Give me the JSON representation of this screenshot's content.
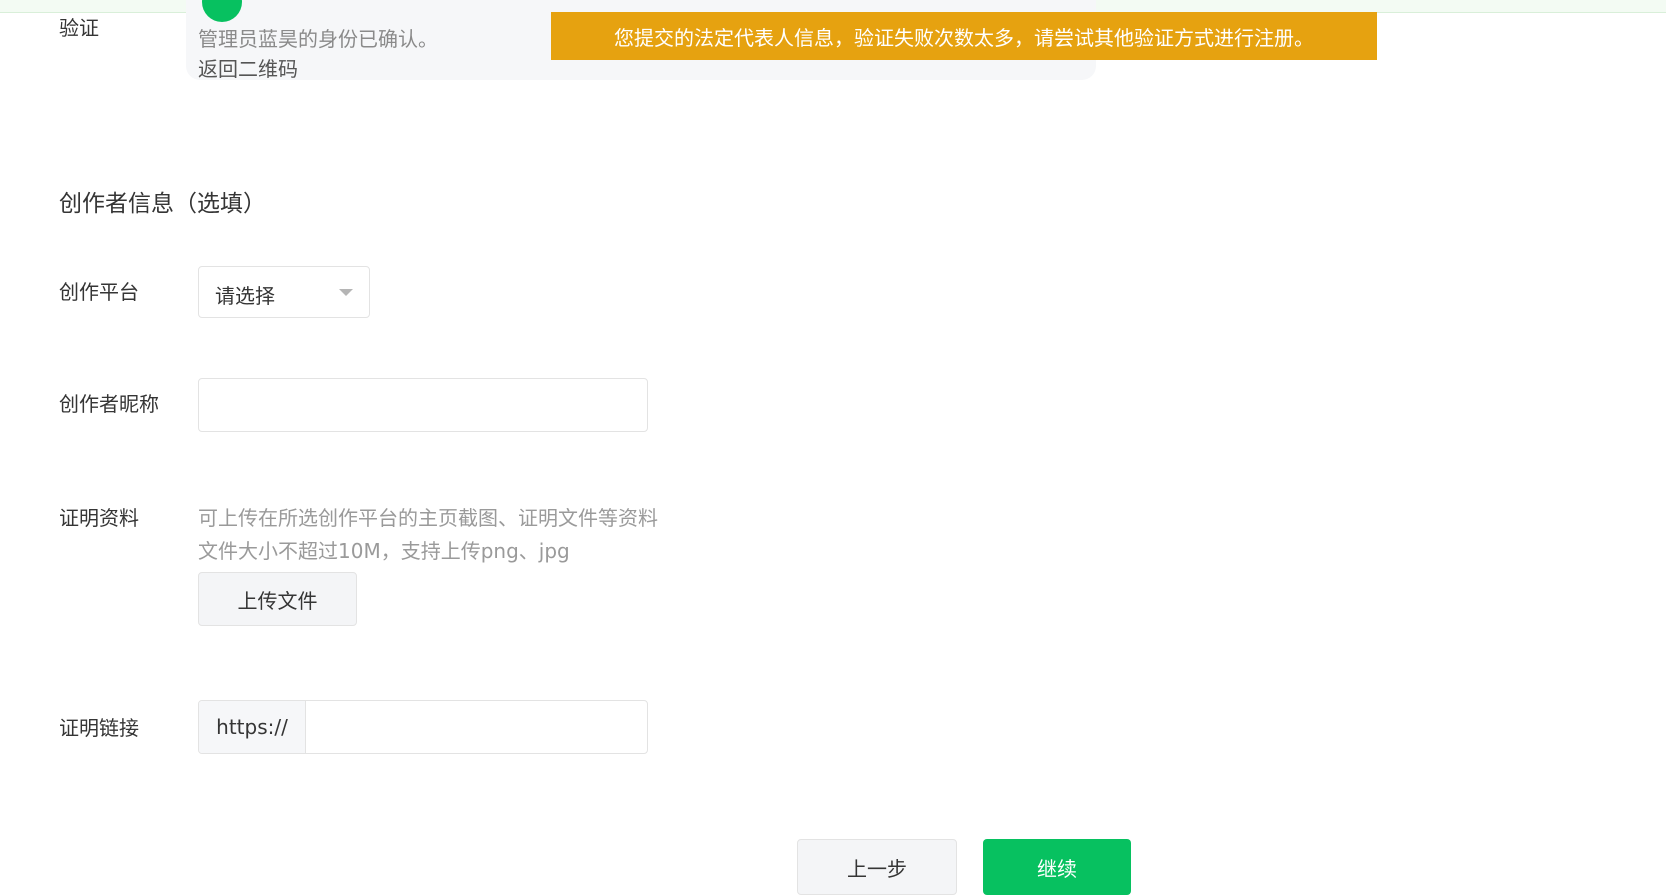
{
  "verification": {
    "label": "验证",
    "status_text": "管理员蓝昊的身份已确认。",
    "back_link": "返回二维码"
  },
  "toast": {
    "message": "您提交的法定代表人信息，验证失败次数太多，请尝试其他验证方式进行注册。",
    "color": "#e6a210"
  },
  "creator_section": {
    "title": "创作者信息（选填）",
    "platform": {
      "label": "创作平台",
      "selected_value": "请选择"
    },
    "nickname": {
      "label": "创作者昵称",
      "value": "",
      "placeholder": ""
    },
    "proof_material": {
      "label": "证明资料",
      "hint_line1": "可上传在所选创作平台的主页截图、证明文件等资料",
      "hint_line2": "文件大小不超过10M，支持上传png、jpg",
      "upload_button": "上传文件"
    },
    "proof_link": {
      "label": "证明链接",
      "prefix": "https://",
      "value": "",
      "placeholder": ""
    }
  },
  "footer": {
    "prev_button": "上一步",
    "next_button": "继续"
  },
  "colors": {
    "primary_green": "#07c160",
    "warning_orange": "#e6a210"
  }
}
